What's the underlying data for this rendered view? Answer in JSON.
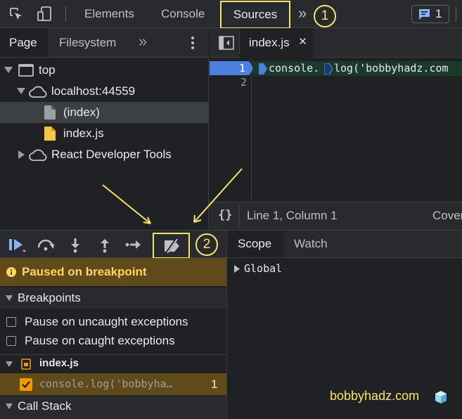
{
  "toolbar": {
    "tabs": [
      "Elements",
      "Console",
      "Sources"
    ],
    "more_glyph": "»",
    "issues_count": "1",
    "callout_1": "1"
  },
  "navigator": {
    "tabs": [
      "Page",
      "Filesystem"
    ],
    "more_glyph": "»",
    "tree": {
      "top": "top",
      "host": "localhost:44559",
      "index": "(index)",
      "indexjs": "index.js",
      "react": "React Developer Tools"
    }
  },
  "editor": {
    "tab_label": "index.js",
    "close_glyph": "×",
    "line_numbers": [
      "1",
      "2"
    ],
    "code_line_1": {
      "part1": "console.",
      "part2": "log('bobbyhadz.com"
    },
    "status_braces": "{}",
    "status_position": "Line 1, Column 1",
    "status_coverage": "Cover"
  },
  "debugger": {
    "callout_2": "2",
    "paused_text": "Paused on breakpoint",
    "breakpoints_header": "Breakpoints",
    "pause_uncaught": "Pause on uncaught exceptions",
    "pause_caught": "Pause on caught exceptions",
    "file_label": "index.js",
    "bp_code": "console.log('bobbyha…",
    "bp_line": "1",
    "call_stack_header": "Call Stack"
  },
  "scope": {
    "tabs": [
      "Scope",
      "Watch"
    ],
    "global_label": "Global"
  },
  "watermark": "bobbyhadz.com",
  "colors": {
    "accent_yellow": "#f7e56b",
    "paused_bg": "#614a19",
    "paused_text": "#fdd663",
    "breakpoint_blue": "#4d7fde",
    "checkbox_orange": "#f29900"
  }
}
